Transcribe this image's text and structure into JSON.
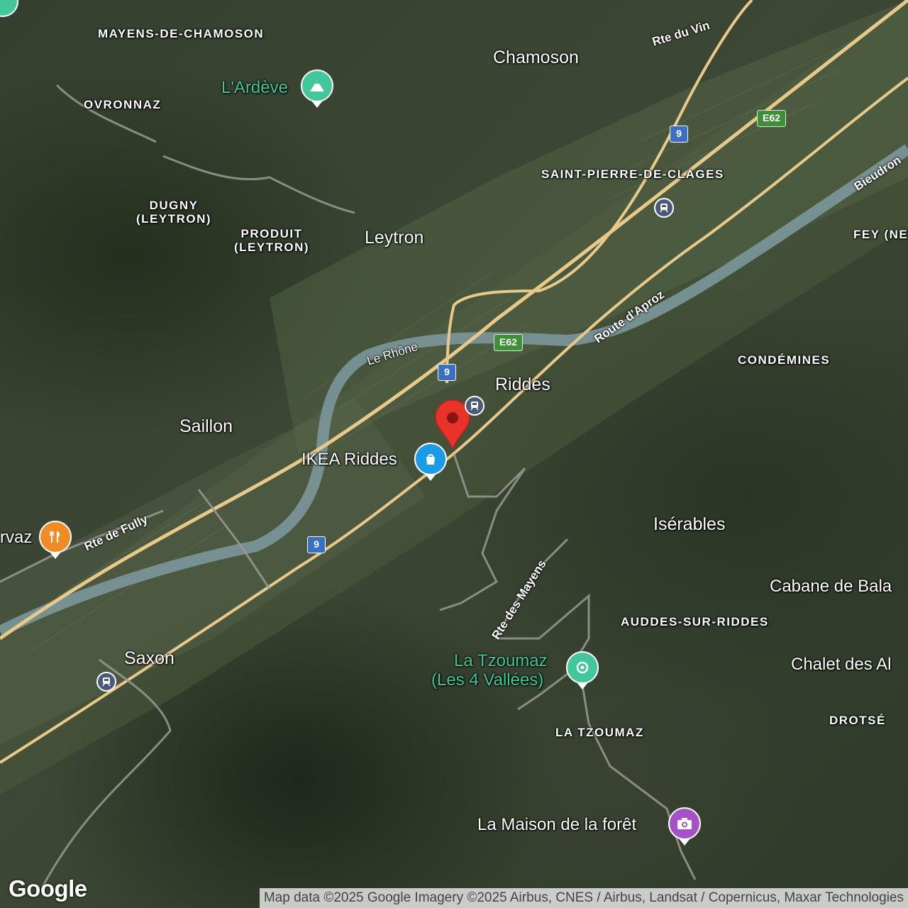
{
  "places": {
    "mayens_de_chamoson": "MAYENS-DE-CHAMOSON",
    "ovronnaz": "OVRONNAZ",
    "dugny": "DUGNY\n(LEYTRON)",
    "produit": "PRODUIT\n(LEYTRON)",
    "chamoson": "Chamoson",
    "saint_pierre": "SAINT-PIERRE-DE-CLAGES",
    "fey": "FEY (NE",
    "leytron": "Leytron",
    "riddes": "Riddes",
    "saillon": "Saillon",
    "condemines": "CONDÉMINES",
    "iserables": "Isérables",
    "auddes": "AUDDES-SUR-RIDDES",
    "saxon": "Saxon",
    "drotse": "DROTSÉ",
    "la_tzoumaz_area": "LA TZOUMAZ"
  },
  "pois": {
    "ardeve": "L'Ardève",
    "ikea": "IKEA Riddes",
    "restaurant_partial": "rvaz",
    "tzoumaz_line1": "La Tzoumaz",
    "tzoumaz_line2": "(Les 4 Vallées)",
    "cabane": "Cabane de Bala",
    "chalet": "Chalet des Al",
    "maison": "La Maison de la forêt"
  },
  "roads": {
    "rte_du_vin": "Rte du Vin",
    "bieudron": "Bieudron",
    "route_aproz": "Route d'Aproz",
    "le_rhone": "Le Rhône",
    "rte_de_fully": "Rte de Fully",
    "rte_des_mayens": "Rte des Mayens"
  },
  "shields": {
    "e62_top": "E62",
    "e62_mid": "E62",
    "nine_top": "9",
    "nine_mid": "9",
    "nine_bottom": "9"
  },
  "icons": {
    "ardeve": "mountain-icon",
    "ikea": "shopping-bag-icon",
    "restaurant": "fork-knife-icon",
    "tzoumaz": "ski-area-icon",
    "maison": "camera-icon",
    "train": "train-station-icon",
    "marker": "location-pin-icon"
  },
  "colors": {
    "poi_green": "#43c69a",
    "ikea_blue": "#1a9be6",
    "restaurant_orange": "#f08c28",
    "museum_purple": "#a552c8",
    "marker_red": "#e8322a",
    "highway": "#e8c98a"
  },
  "attribution": "Map data ©2025 Google Imagery ©2025 Airbus, CNES / Airbus, Landsat / Copernicus, Maxar Technologies",
  "logo": "Google"
}
